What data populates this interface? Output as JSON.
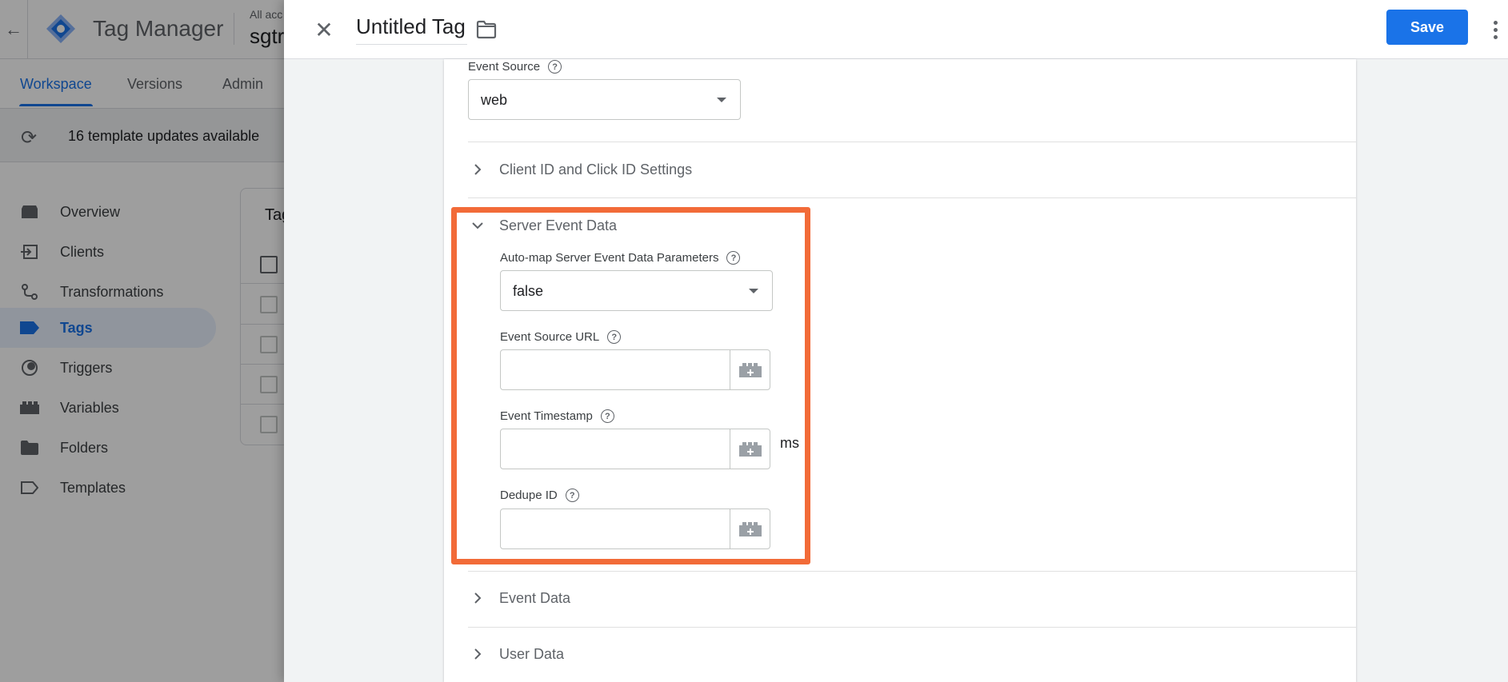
{
  "app": {
    "title": "Tag Manager",
    "account_small": "All acc",
    "account_big": "sgtr",
    "back_icon": "arrow-left-icon"
  },
  "tabs": [
    {
      "label": "Workspace",
      "active": true
    },
    {
      "label": "Versions",
      "active": false
    },
    {
      "label": "Admin",
      "active": false
    }
  ],
  "update_bar": {
    "text": "16 template updates available",
    "icon": "refresh-icon"
  },
  "nav": [
    {
      "label": "Overview",
      "icon": "overview-icon"
    },
    {
      "label": "Clients",
      "icon": "clients-icon"
    },
    {
      "label": "Transformations",
      "icon": "transformations-icon"
    },
    {
      "label": "Tags",
      "icon": "tag-icon",
      "active": true
    },
    {
      "label": "Triggers",
      "icon": "triggers-icon"
    },
    {
      "label": "Variables",
      "icon": "variables-icon"
    },
    {
      "label": "Folders",
      "icon": "folder-icon"
    },
    {
      "label": "Templates",
      "icon": "templates-icon"
    }
  ],
  "tags_card": {
    "title": "Tag"
  },
  "drawer": {
    "tag_name": "Untitled Tag",
    "save_label": "Save",
    "close_icon": "close-icon",
    "folder_icon": "folder-icon",
    "more_icon": "more-vert-icon"
  },
  "event_source": {
    "label": "Event Source",
    "value": "web"
  },
  "sections": {
    "client_id": "Client ID and Click ID Settings",
    "server_event_data": "Server Event Data",
    "event_data": "Event Data",
    "user_data": "User Data"
  },
  "server_event_data": {
    "automap": {
      "label": "Auto-map Server Event Data Parameters",
      "value": "false"
    },
    "event_source_url": {
      "label": "Event Source URL",
      "value": ""
    },
    "event_timestamp": {
      "label": "Event Timestamp",
      "value": "",
      "unit": "ms"
    },
    "dedupe_id": {
      "label": "Dedupe ID",
      "value": ""
    }
  },
  "colors": {
    "accent": "#1a73e8",
    "highlight": "#f26b38"
  }
}
